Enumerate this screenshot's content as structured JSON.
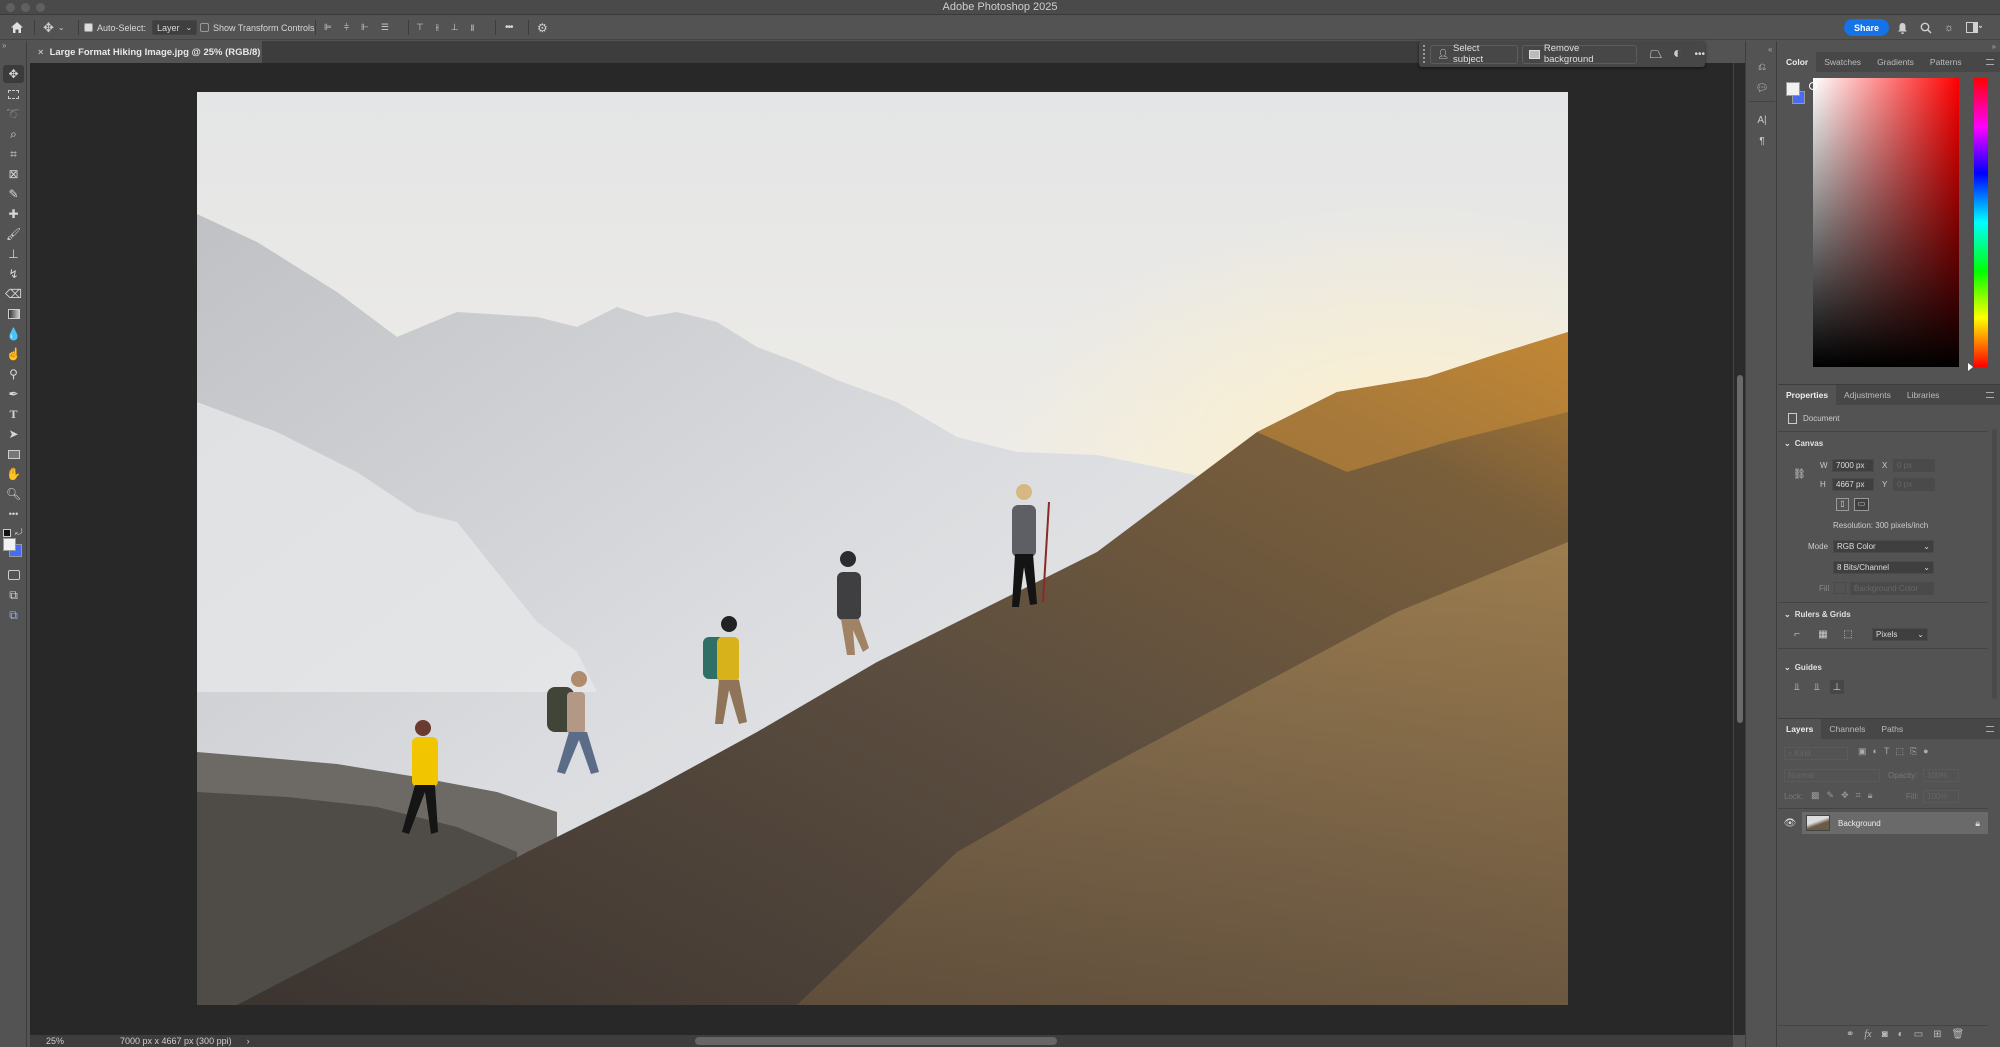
{
  "app": {
    "title": "Adobe Photoshop 2025"
  },
  "options_bar": {
    "auto_select_label": "Auto-Select:",
    "auto_select_checked": true,
    "auto_select_target": "Layer",
    "show_transform_label": "Show Transform Controls",
    "show_transform_checked": false,
    "more_label": "•••",
    "share_label": "Share"
  },
  "document": {
    "tab_title": "Large Format Hiking Image.jpg @ 25% (RGB/8)",
    "close_glyph": "×"
  },
  "context_bar": {
    "select_subject": "Select subject",
    "remove_background": "Remove background",
    "more": "•••"
  },
  "status": {
    "zoom": "25%",
    "doc_info": "7000 px x 4667 px (300 ppi)",
    "arrow": "›"
  },
  "color_panel": {
    "tabs": [
      "Color",
      "Swatches",
      "Gradients",
      "Patterns"
    ],
    "active_tab": "Color",
    "foreground": "#f2f2f2",
    "background": "#4a6cf0",
    "hue_base": "#ff0000"
  },
  "properties_panel": {
    "tabs": [
      "Properties",
      "Adjustments",
      "Libraries"
    ],
    "active_tab": "Properties",
    "doc_label": "Document",
    "canvas_section": "Canvas",
    "w_label": "W",
    "w_value": "7000 px",
    "h_label": "H",
    "h_value": "4667 px",
    "x_label": "X",
    "x_placeholder": "0 px",
    "y_label": "Y",
    "y_placeholder": "0 px",
    "resolution": "Resolution: 300 pixels/inch",
    "mode_label": "Mode",
    "mode_value": "RGB Color",
    "bits_value": "8 Bits/Channel",
    "fill_label": "Fill",
    "fill_value": "Background Color",
    "rulers_section": "Rulers & Grids",
    "units_value": "Pixels",
    "guides_section": "Guides"
  },
  "layers_panel": {
    "tabs": [
      "Layers",
      "Channels",
      "Paths"
    ],
    "active_tab": "Layers",
    "kind_placeholder": "Kind",
    "blend_mode": "Normal",
    "opacity_label": "Opacity:",
    "opacity_value": "100%",
    "lock_label": "Lock:",
    "fill_label": "Fill:",
    "fill_value": "100%",
    "layers": [
      {
        "name": "Background",
        "visible": true,
        "locked": true
      }
    ]
  },
  "tools": [
    "move",
    "marquee",
    "lasso",
    "object-select",
    "crop",
    "frame",
    "eyedropper",
    "healing",
    "brush",
    "clone-stamp",
    "history-brush",
    "eraser",
    "gradient",
    "blur",
    "dodge",
    "pen",
    "type",
    "path-select",
    "rectangle",
    "hand",
    "zoom",
    "more"
  ]
}
